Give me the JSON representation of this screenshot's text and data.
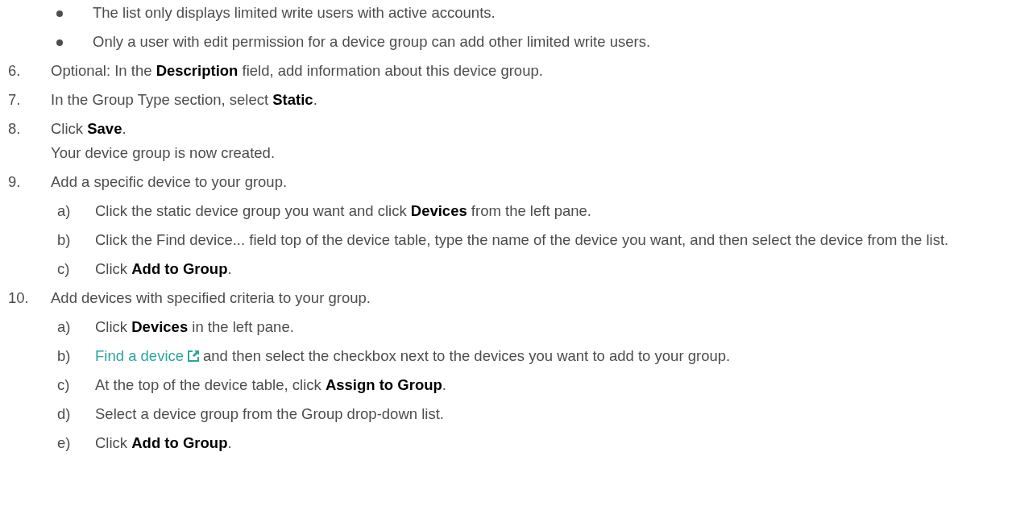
{
  "bullets": [
    "The list only displays limited write users with active accounts.",
    "Only a user with edit permission for a device group can add other limited write users."
  ],
  "steps": [
    {
      "number": "6.",
      "text": "Optional: In the **Description** field, add information about this device group."
    },
    {
      "number": "7.",
      "text": "In the Group Type section, select **Static**."
    },
    {
      "number": "8.",
      "text": "Click **Save**.",
      "result": "Your device group is now created."
    },
    {
      "number": "9.",
      "text": "Add a specific device to your group.",
      "substeps": [
        {
          "letter": "a)",
          "text": "Click the static device group you want and click **Devices** from the left pane."
        },
        {
          "letter": "b)",
          "text": "Click the Find device... field top of the device table, type the name of the device you want, and then select the device from the list."
        },
        {
          "letter": "c)",
          "text": "Click **Add to Group**."
        }
      ]
    },
    {
      "number": "10.",
      "text": "Add devices with specified criteria to your group.",
      "substeps": [
        {
          "letter": "a)",
          "text": "Click **Devices** in the left pane."
        },
        {
          "letter": "b)",
          "link": "Find a device",
          "text": "and then select the checkbox next to the devices you want to add to your group."
        },
        {
          "letter": "c)",
          "text": "At the top of the device table, click **Assign to Group**."
        },
        {
          "letter": "d)",
          "text": "Select a device group from the Group drop-down list."
        },
        {
          "letter": "e)",
          "text": "Click **Add to Group**."
        }
      ]
    }
  ]
}
